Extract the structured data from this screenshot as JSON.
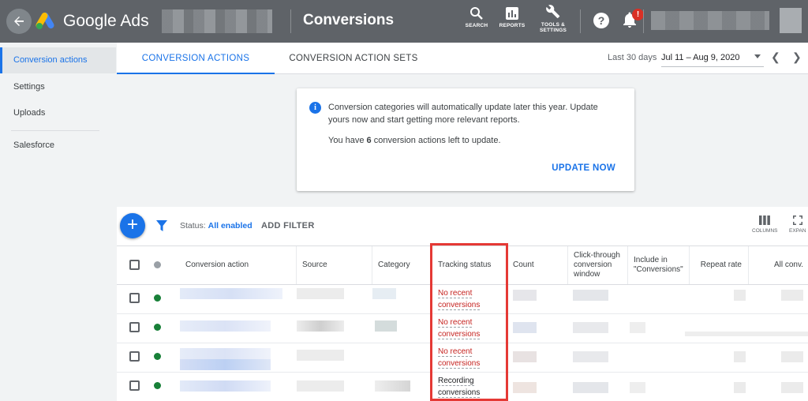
{
  "header": {
    "brand": "Google Ads",
    "page_title": "Conversions",
    "tools": [
      {
        "label": "SEARCH",
        "icon": "search-icon"
      },
      {
        "label": "REPORTS",
        "icon": "reports-icon"
      },
      {
        "label": "TOOLS &",
        "label2": "SETTINGS",
        "icon": "wrench-icon"
      }
    ],
    "notification_badge": "!"
  },
  "sidebar": {
    "items": [
      {
        "label": "Conversion actions",
        "active": true
      },
      {
        "label": "Settings"
      },
      {
        "label": "Uploads"
      },
      {
        "label": "Salesforce"
      }
    ]
  },
  "tabs": [
    {
      "label": "CONVERSION ACTIONS",
      "active": true
    },
    {
      "label": "CONVERSION ACTION SETS"
    }
  ],
  "date_range": {
    "label": "Last 30 days",
    "value": "Jul 11 – Aug 9, 2020"
  },
  "notice": {
    "text": "Conversion categories will automatically update later this year. Update yours now and start getting more relevant reports.",
    "count_prefix": "You have ",
    "count": "6",
    "count_suffix": " conversion actions left to update.",
    "button": "UPDATE NOW"
  },
  "toolbar": {
    "status_label": "Status: ",
    "status_value": "All enabled",
    "add_filter": "ADD FILTER",
    "columns": "COLUMNS",
    "expand": "EXPAN"
  },
  "table": {
    "headers": {
      "conversion_action": "Conversion action",
      "source": "Source",
      "category": "Category",
      "tracking_status": "Tracking status",
      "count": "Count",
      "ctw": "Click-through conversion window",
      "include": "Include in \"Conversions\"",
      "repeat_rate": "Repeat rate",
      "all_conv": "All conv."
    },
    "rows": [
      {
        "tracking_line1": "No recent",
        "tracking_line2": "conversions",
        "status": "warning"
      },
      {
        "tracking_line1": "No recent",
        "tracking_line2": "conversions",
        "status": "warning"
      },
      {
        "tracking_line1": "No recent",
        "tracking_line2": "conversions",
        "status": "warning"
      },
      {
        "tracking_line1": "Recording",
        "tracking_line2": "conversions",
        "status": "ok"
      }
    ]
  },
  "colors": {
    "accent": "#1a73e8",
    "warning": "#c5221f",
    "enabled": "#188038",
    "highlight": "#e53935"
  }
}
